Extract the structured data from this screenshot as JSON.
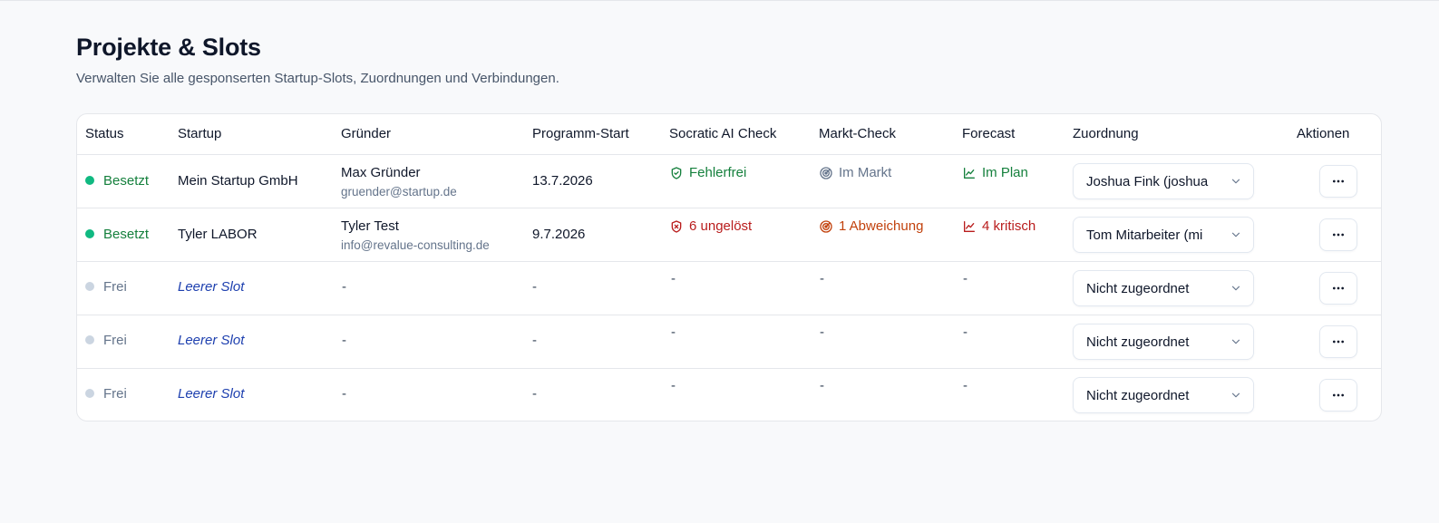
{
  "header": {
    "title": "Projekte & Slots",
    "subtitle": "Verwalten Sie alle gesponserten Startup-Slots, Zuordnungen und Verbindungen."
  },
  "table": {
    "columns": {
      "status": "Status",
      "startup": "Startup",
      "founder": "Gründer",
      "start": "Programm-Start",
      "socratic": "Socratic AI Check",
      "market": "Markt-Check",
      "forecast": "Forecast",
      "assignment": "Zuordnung",
      "actions": "Aktionen"
    },
    "rows": [
      {
        "status": "Besetzt",
        "status_color": "#10b981",
        "startup": "Mein Startup GmbH",
        "founder_name": "Max Gründer",
        "founder_email": "gruender@startup.de",
        "start": "13.7.2026",
        "socratic": "Fehlerfrei",
        "socratic_icon": "shield-check-icon",
        "market": "Im Markt",
        "market_icon": "radar-icon",
        "forecast": "Im Plan",
        "forecast_icon": "chart-line-icon",
        "assignment": "Joshua Fink (joshua"
      },
      {
        "status": "Besetzt",
        "status_color": "#10b981",
        "startup": "Tyler LABOR",
        "founder_name": "Tyler Test",
        "founder_email": "info@revalue-consulting.de",
        "start": "9.7.2026",
        "socratic": "6 ungelöst",
        "socratic_icon": "shield-x-icon",
        "market": "1 Abweichung",
        "market_icon": "radar-icon",
        "forecast": "4 kritisch",
        "forecast_icon": "chart-line-icon",
        "assignment": "Tom Mitarbeiter (mi"
      },
      {
        "status": "Frei",
        "status_color": "#cbd5e1",
        "startup": "Leerer Slot",
        "founder_name": "-",
        "start": "-",
        "socratic": "-",
        "market": "-",
        "forecast": "-",
        "assignment": "Nicht zugeordnet"
      },
      {
        "status": "Frei",
        "status_color": "#cbd5e1",
        "startup": "Leerer Slot",
        "founder_name": "-",
        "start": "-",
        "socratic": "-",
        "market": "-",
        "forecast": "-",
        "assignment": "Nicht zugeordnet"
      },
      {
        "status": "Frei",
        "status_color": "#cbd5e1",
        "startup": "Leerer Slot",
        "founder_name": "-",
        "start": "-",
        "socratic": "-",
        "market": "-",
        "forecast": "-",
        "assignment": "Nicht zugeordnet"
      }
    ]
  },
  "colors": {
    "ok": "#15803d",
    "error": "#b91c1c",
    "warning": "#c2410c",
    "muted": "#64748b"
  }
}
